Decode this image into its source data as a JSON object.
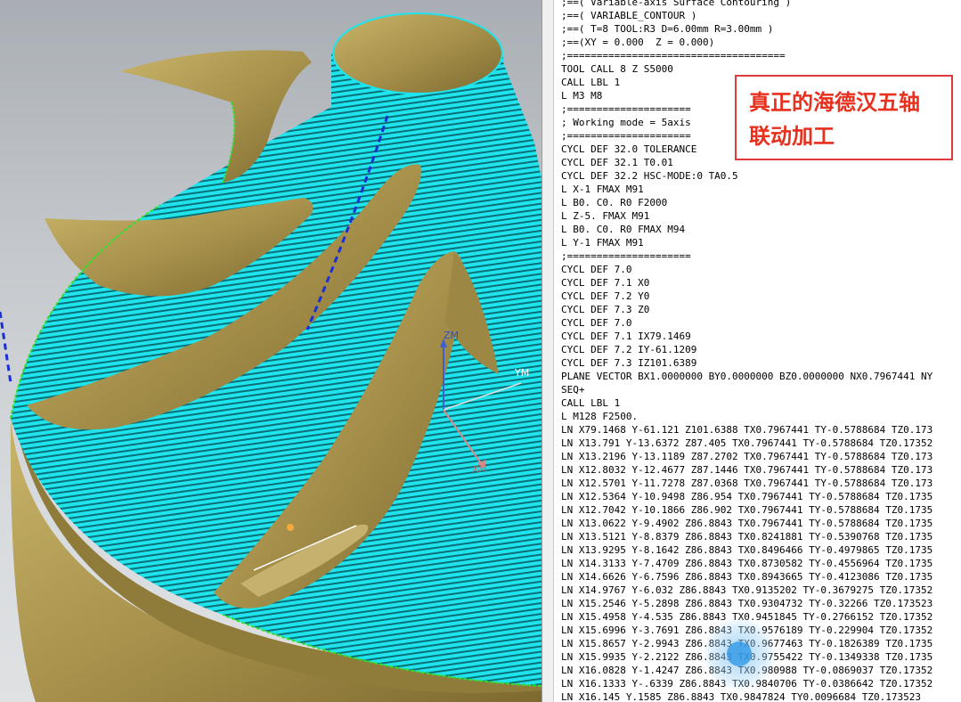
{
  "viewport": {
    "axes": {
      "z_label": "ZM",
      "y_label": "YM",
      "x_label": "XM"
    },
    "colors": {
      "part": "#b8a25a",
      "toolpath": "#19e6ef",
      "boundary": "#2fe02f",
      "tool_axis": "#1b2fd6",
      "background": "#c4c8cc"
    }
  },
  "code_panel": {
    "lines": [
      ";==( Variable-axis Surface Contouring )",
      ";==( VARIABLE_CONTOUR )",
      ";==( T=8 TOOL:R3 D=6.00mm R=3.00mm )",
      ";==(XY = 0.000  Z = 0.000)",
      ";=====================================",
      "TOOL CALL 8 Z S5000",
      "CALL LBL 1",
      "L M3 M8",
      ";=====================",
      "; Working mode = 5axis",
      ";=====================",
      "CYCL DEF 32.0 TOLERANCE",
      "CYCL DEF 32.1 T0.01",
      "CYCL DEF 32.2 HSC-MODE:0 TA0.5",
      "L X-1 FMAX M91",
      "L B0. C0. R0 F2000",
      "L Z-5. FMAX M91",
      "L B0. C0. R0 FMAX M94",
      "L Y-1 FMAX M91",
      ";=====================",
      "CYCL DEF 7.0",
      "CYCL DEF 7.1 X0",
      "CYCL DEF 7.2 Y0",
      "CYCL DEF 7.3 Z0",
      "CYCL DEF 7.0",
      "CYCL DEF 7.1 IX79.1469",
      "CYCL DEF 7.2 IY-61.1209",
      "CYCL DEF 7.3 IZ101.6389",
      "PLANE VECTOR BX1.0000000 BY0.0000000 BZ0.0000000 NX0.7967441 NY",
      "SEQ+",
      "CALL LBL 1",
      "L M128 F2500.",
      "LN X79.1468 Y-61.121 Z101.6388 TX0.7967441 TY-0.5788684 TZ0.173",
      "LN X13.791 Y-13.6372 Z87.405 TX0.7967441 TY-0.5788684 TZ0.17352",
      "LN X13.2196 Y-13.1189 Z87.2702 TX0.7967441 TY-0.5788684 TZ0.173",
      "LN X12.8032 Y-12.4677 Z87.1446 TX0.7967441 TY-0.5788684 TZ0.173",
      "LN X12.5701 Y-11.7278 Z87.0368 TX0.7967441 TY-0.5788684 TZ0.173",
      "LN X12.5364 Y-10.9498 Z86.954 TX0.7967441 TY-0.5788684 TZ0.1735",
      "LN X12.7042 Y-10.1866 Z86.902 TX0.7967441 TY-0.5788684 TZ0.1735",
      "LN X13.0622 Y-9.4902 Z86.8843 TX0.7967441 TY-0.5788684 TZ0.1735",
      "LN X13.5121 Y-8.8379 Z86.8843 TX0.8241881 TY-0.5390768 TZ0.1735",
      "LN X13.9295 Y-8.1642 Z86.8843 TX0.8496466 TY-0.4979865 TZ0.1735",
      "LN X14.3133 Y-7.4709 Z86.8843 TX0.8730582 TY-0.4556964 TZ0.1735",
      "LN X14.6626 Y-6.7596 Z86.8843 TX0.8943665 TY-0.4123086 TZ0.1735",
      "LN X14.9767 Y-6.032 Z86.8843 TX0.9135202 TY-0.3679275 TZ0.17352",
      "LN X15.2546 Y-5.2898 Z86.8843 TX0.9304732 TY-0.32266 TZ0.173523",
      "LN X15.4958 Y-4.535 Z86.8843 TX0.9451845 TY-0.2766152 TZ0.17352",
      "LN X15.6996 Y-3.7691 Z86.8843 TX0.9576189 TY-0.229904 TZ0.17352",
      "LN X15.8657 Y-2.9943 Z86.8843 TX0.9677463 TY-0.1826389 TZ0.1735",
      "LN X15.9935 Y-2.2122 Z86.8843 TX0.9755422 TY-0.1349338 TZ0.1735",
      "LN X16.0828 Y-1.4247 Z86.8843 TX0.980988 TY-0.0869037 TZ0.17352",
      "LN X16.1333 Y-.6339 Z86.8843 TX0.9840706 TY-0.0386642 TZ0.17352",
      "LN X16.145 Y.1585 Z86.8843 TX0.9847824 TY0.0096684 TZ0.173523"
    ]
  },
  "callout": {
    "line1": "真正的海德汉五轴",
    "line2": "联动加工"
  }
}
